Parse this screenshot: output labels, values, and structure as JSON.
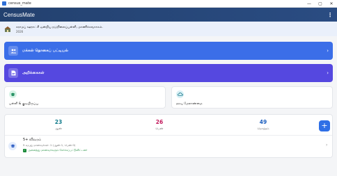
{
  "window": {
    "title": "census_mate",
    "controls": {
      "minimize": "—",
      "maximize": "▢",
      "close": "✕"
    }
  },
  "appbar": {
    "title": "CensusMate",
    "menu_icon": "⋮"
  },
  "school": {
    "icon": "school-building-icon",
    "name": "கராமப் ஊராட்சி ஒன்றிய நடுநிலைப்பள்ளி, மாணிக்கவாசகம்.",
    "year": "2026"
  },
  "cards": {
    "people": {
      "label": "மக்கள் தொகைப் பட்டியல்",
      "icon": "people-icon",
      "color": "#3b6ee8"
    },
    "reports": {
      "label": "அறிக்கைகள்",
      "icon": "document-icon",
      "color": "#5548e0"
    }
  },
  "small_cards": {
    "school": {
      "label": "பள்ளி & குடியிருப்பு",
      "icon": "school-cap-icon"
    },
    "data": {
      "label": "தரவு மேலாண்மை",
      "icon": "cloud-icon"
    }
  },
  "stats": {
    "boys": {
      "value": "23",
      "caption": "ஆண்"
    },
    "girls": {
      "value": "26",
      "caption": "பெண்"
    },
    "total": {
      "value": "49",
      "caption": "மொத்தம்"
    },
    "add_label": "+"
  },
  "grade": {
    "title": "5+ விவரம்",
    "subtitle": "5 வயது மாணவர்கள்: 1 (ஆண் 1, பெண் 0)",
    "status": "அனைத்து மாணவர்களும் சேர்க்கப்பட்டுவிட்டனர்",
    "check": "✓"
  },
  "colors": {
    "accent": "#2f6fe6",
    "appbar": "#23416f",
    "success": "#1a8a3a"
  }
}
